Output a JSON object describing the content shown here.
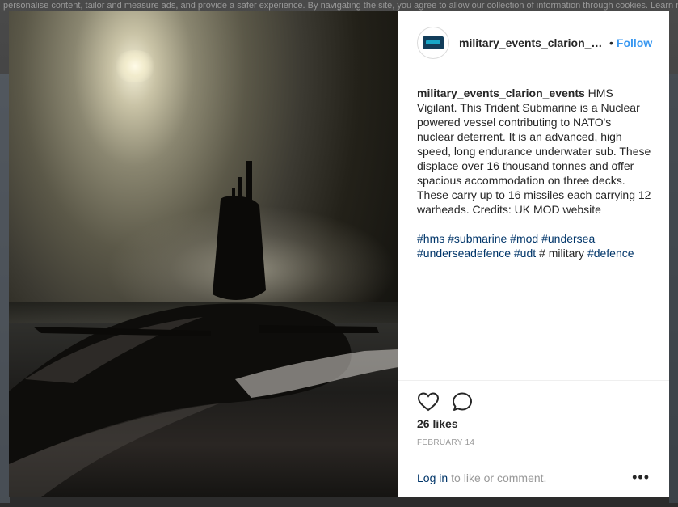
{
  "background": {
    "cookie_notice": "personalise content, tailor and measure ads, and provide a safer experience. By navigating the site, you agree to allow our collection of information through cookies. Learn more, including about available controls: Cookies Policy."
  },
  "post": {
    "username": "military_events_clarion_ev...",
    "follow_separator": "•",
    "follow_label": "Follow",
    "caption_user": "military_events_clarion_events",
    "caption_text": "HMS Vigilant. This Trident Submarine is a Nuclear powered vessel contributing to NATO's nuclear deterrent. It is an advanced, high speed, long endurance underwater sub. These displace over 16 thousand tonnes and offer spacious accommodation on three decks. These carry up to 16 missiles each carrying 12 warheads.  Credits: UK MOD website",
    "hashtags": [
      "#hms",
      "#submarine",
      "#mod",
      "#undersea",
      "#underseadefence",
      "#udt"
    ],
    "plain_tag": "# military",
    "last_tag": "#defence",
    "likes": "26 likes",
    "date": "FEBRUARY 14",
    "login_label": "Log in",
    "login_rest": "to like or comment.",
    "more_label": "•••"
  },
  "icons": {
    "like": "heart-icon",
    "comment": "comment-bubble-icon",
    "more": "more-options-icon"
  },
  "colors": {
    "link_blue": "#003569",
    "follow_blue": "#3897f0",
    "text": "#262626",
    "muted": "#999999"
  }
}
